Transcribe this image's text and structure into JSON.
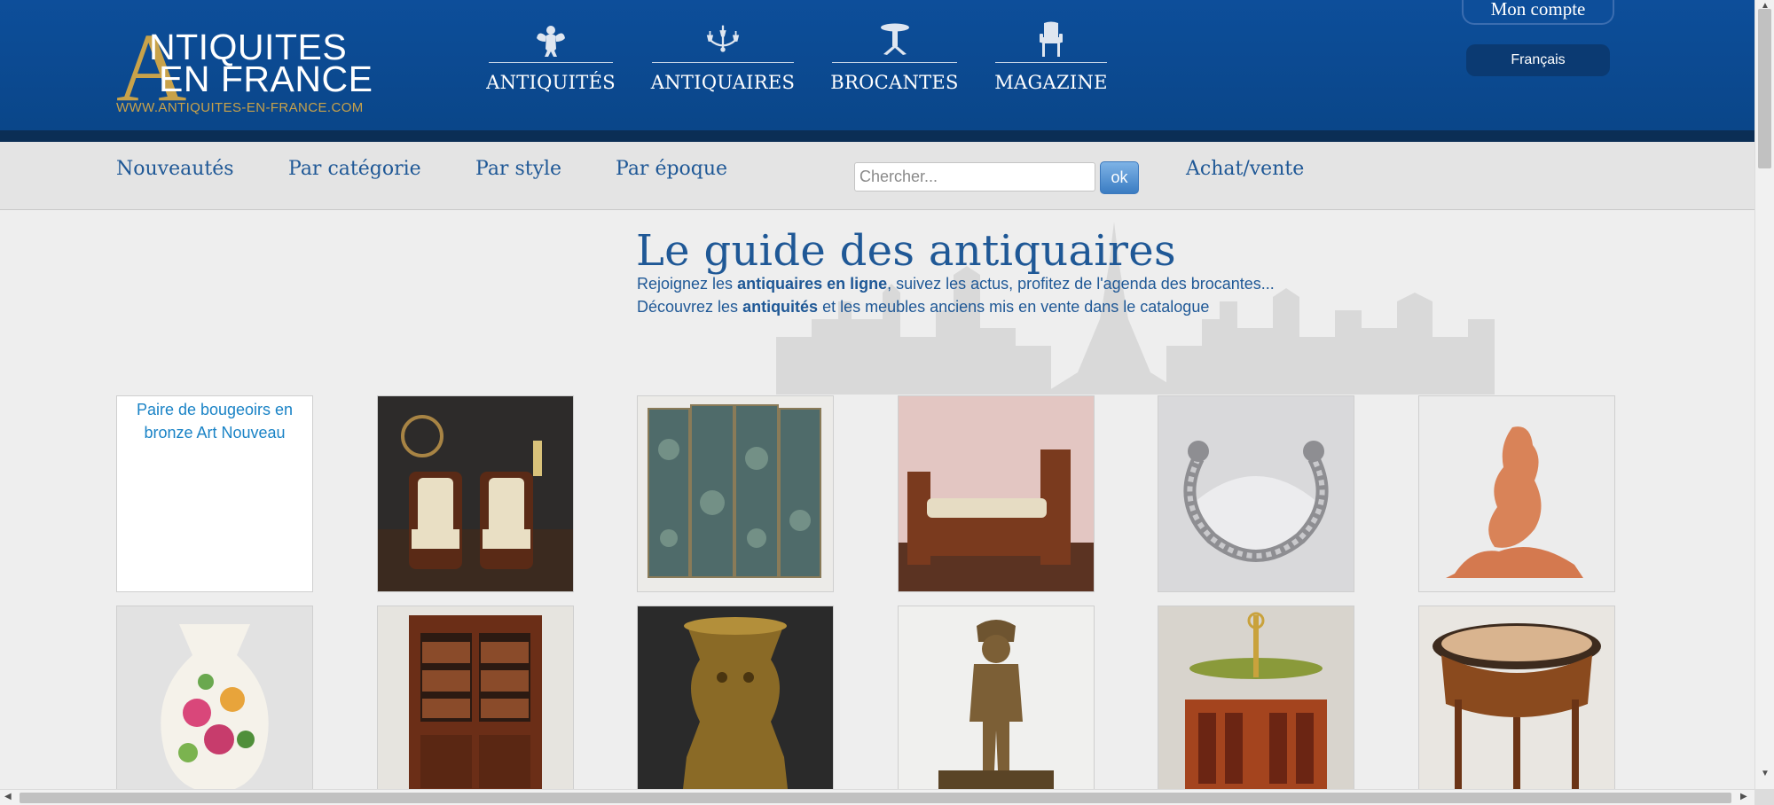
{
  "brand": {
    "logo_initial": "A",
    "logo_line1": "NTIQUITES",
    "logo_line2": "EN FRANCE",
    "url": "WWW.ANTIQUITES-EN-FRANCE.COM",
    "gold": "#c8a24a",
    "blue": "#0d4e9a"
  },
  "main_nav": [
    {
      "label": "ANTIQUITÉS",
      "icon": "cherub-icon"
    },
    {
      "label": "ANTIQUAIRES",
      "icon": "chandelier-icon"
    },
    {
      "label": "BROCANTES",
      "icon": "pedestal-table-icon"
    },
    {
      "label": "MAGAZINE",
      "icon": "armchair-icon"
    }
  ],
  "account": {
    "label": "Mon compte"
  },
  "language": {
    "selected": "Français"
  },
  "sub_nav": [
    "Nouveautés",
    "Par catégorie",
    "Par style",
    "Par époque"
  ],
  "search": {
    "placeholder": "Chercher...",
    "button": "ok"
  },
  "buy_sell": "Achat/vente",
  "hero": {
    "title": "Le guide des antiquaires",
    "line1_pre": "Rejoignez les ",
    "line1_bold": "antiquaires en ligne",
    "line1_post": ", suivez les actus, profitez de l'agenda des brocantes...",
    "line2_pre": "Découvrez les ",
    "line2_bold": "antiquités",
    "line2_post": " et les meubles anciens mis en vente dans le catalogue"
  },
  "products": [
    {
      "alt": "Paire de bougeoirs en bronze Art Nouveau",
      "image": "broken-image"
    },
    {
      "image": "pair-of-armchairs"
    },
    {
      "image": "folding-screen"
    },
    {
      "image": "daybed"
    },
    {
      "image": "silver-bracelet"
    },
    {
      "image": "terracotta-sculpture"
    },
    {
      "image": "floral-vase"
    },
    {
      "image": "bookcase"
    },
    {
      "image": "bronze-figure-vase"
    },
    {
      "image": "bronze-boy-statue"
    },
    {
      "image": "bouillotte-lamp-on-revolving-bookcase"
    },
    {
      "image": "marble-top-side-table"
    }
  ]
}
